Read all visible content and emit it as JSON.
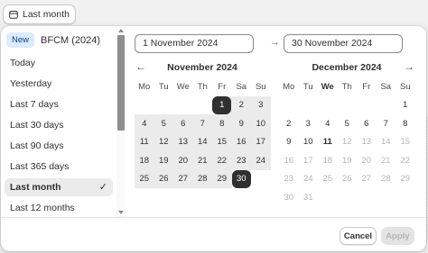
{
  "trigger": {
    "label": "Last month",
    "icon": "calendar-icon"
  },
  "sidebar": {
    "new_badge": "New",
    "featured": "BFCM (2024)",
    "items": [
      "Today",
      "Yesterday",
      "Last 7 days",
      "Last 30 days",
      "Last 90 days",
      "Last 365 days",
      "Last month",
      "Last 12 months"
    ],
    "selected_index": 6
  },
  "inputs": {
    "start": "1 November 2024",
    "end": "30 November 2024"
  },
  "weekdays": [
    "Mo",
    "Tu",
    "We",
    "Th",
    "Fr",
    "Sa",
    "Su"
  ],
  "calendars": [
    {
      "title": "November 2024",
      "offset": 4,
      "days": 30,
      "range_start": 1,
      "range_end": 30,
      "disabled_from": null,
      "today": null
    },
    {
      "title": "December 2024",
      "offset": 6,
      "days": 31,
      "range_start": null,
      "range_end": null,
      "disabled_from": 12,
      "today": 11
    }
  ],
  "footer": {
    "cancel": "Cancel",
    "apply": "Apply"
  },
  "colors": {
    "accent": "#303030",
    "range": "#ebebeb",
    "badge_bg": "#dcecfe",
    "badge_text": "#0a3b8c",
    "disabled": "#b5b5b5"
  }
}
